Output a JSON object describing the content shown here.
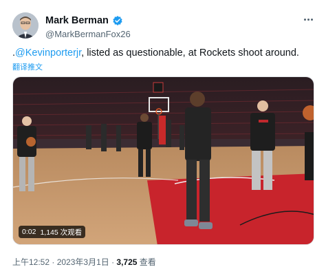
{
  "author": {
    "name": "Mark Berman",
    "handle": "@MarkBermanFox26",
    "avatar_icon": "person-avatar",
    "verified_icon": "verified-badge-icon",
    "verified_color": "#1d9bf0"
  },
  "menu": {
    "icon": "more-options-icon"
  },
  "tweet": {
    "text_prefix": ".",
    "mention": "@Kevinporterjr",
    "text_rest": ", listed as questionable, at Rockets shoot around.",
    "translate_label": "翻译推文",
    "link_color": "#1d9bf0"
  },
  "video": {
    "duration": "0:02",
    "views": "1,145 次观看",
    "scene": "basketball-arena-shootaround"
  },
  "meta": {
    "timestamp": "上午12:52 · 2023年3月1日 · ",
    "view_count": "3,725",
    "view_label": " 查看"
  }
}
